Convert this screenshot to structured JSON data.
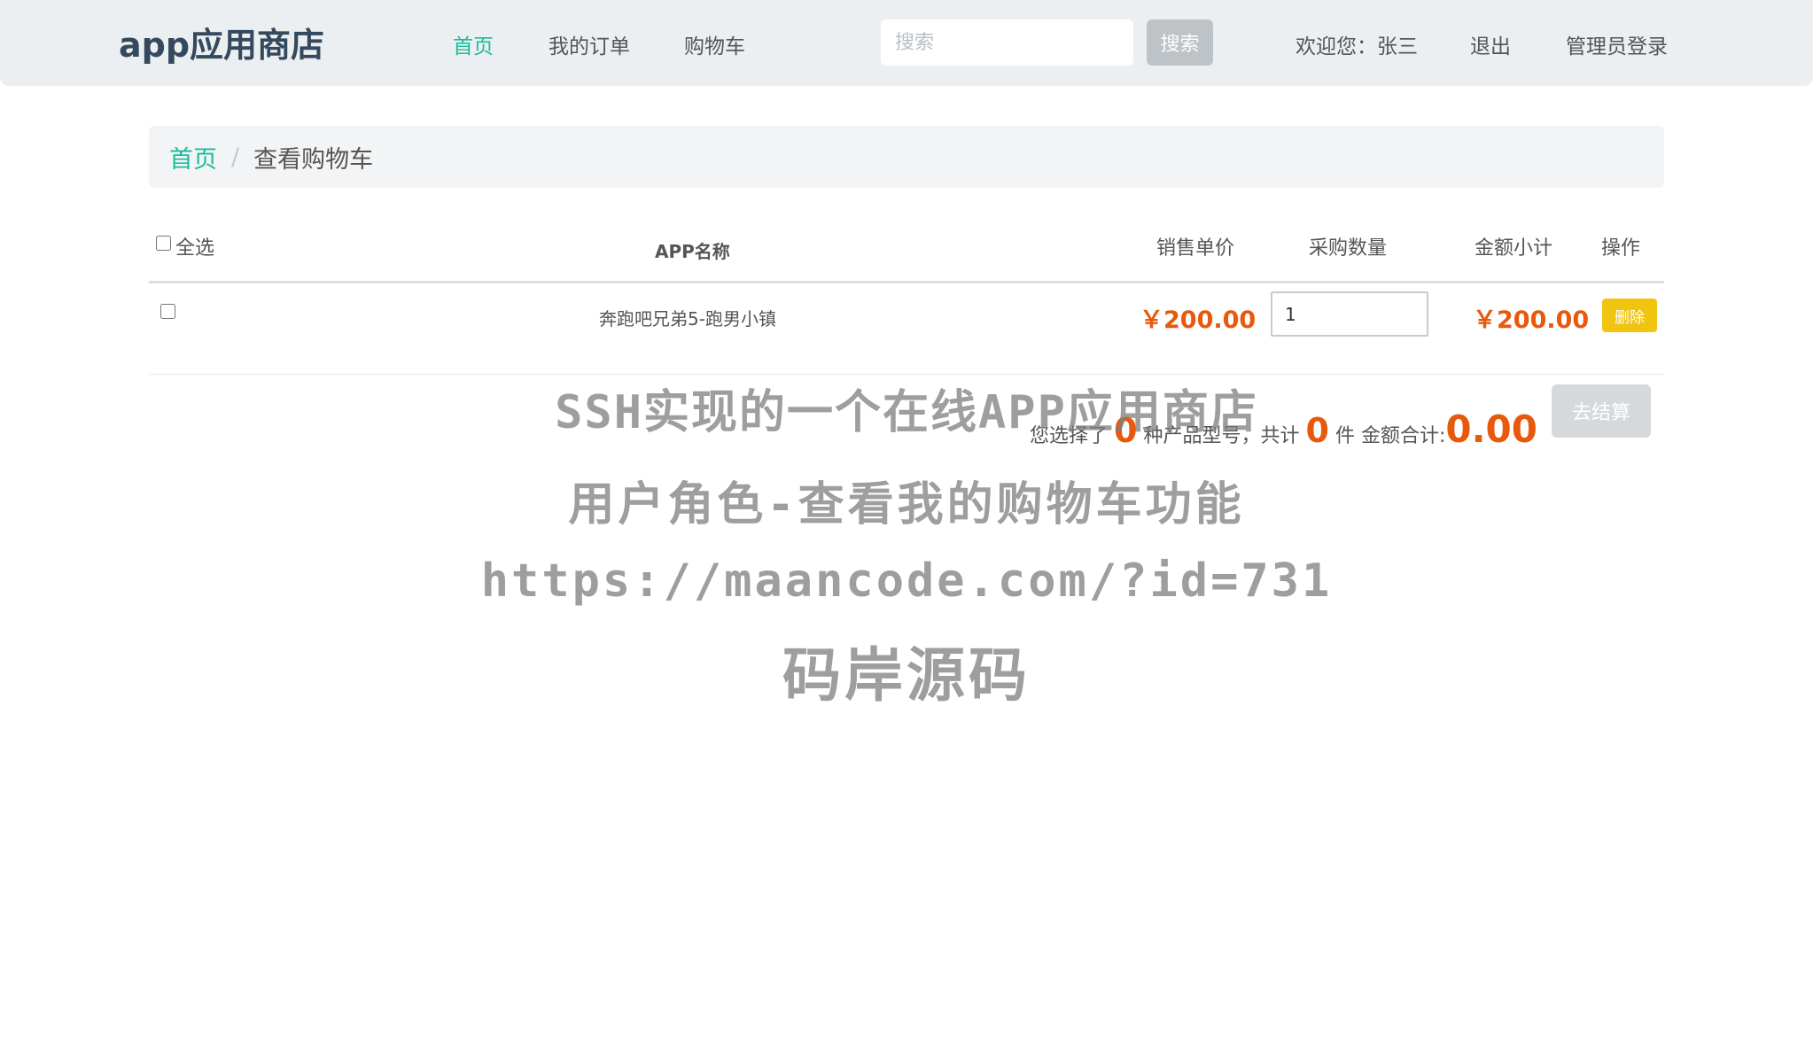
{
  "navbar": {
    "brand": "app应用商店",
    "links": [
      "首页",
      "我的订单",
      "购物车"
    ],
    "search_placeholder": "搜索",
    "search_button": "搜索",
    "welcome": "欢迎您：张三",
    "logout": "退出",
    "admin_login": "管理员登录"
  },
  "breadcrumb": {
    "home": "首页",
    "separator": "/",
    "current": "查看购物车"
  },
  "cart": {
    "headers": {
      "select_all": "全选",
      "name": "APP名称",
      "unit_price": "销售单价",
      "quantity": "采购数量",
      "subtotal": "金额小计",
      "action": "操作"
    },
    "rows": [
      {
        "name": "奔跑吧兄弟5-跑男小镇",
        "unit_price": "￥200.00",
        "quantity": "1",
        "subtotal": "￥200.00",
        "delete_label": "删除"
      }
    ],
    "summary": {
      "prefix": "您选择了",
      "kinds": "0",
      "kinds_suffix": "种产品型号，共计",
      "count": "0",
      "count_suffix": "件",
      "total_label": "金额合计:",
      "total": "0.00"
    },
    "checkout_button": "去结算"
  },
  "watermark": {
    "line1": "SSH实现的一个在线APP应用商店",
    "line2": "用户角色-查看我的购物车功能",
    "line3": "https://maancode.com/?id=731",
    "line4": "码岸源码"
  },
  "colors": {
    "accent": "#1abc9c",
    "price": "#e8590c",
    "delete_button": "#f1c40f",
    "navbar_bg": "#eceff1"
  }
}
